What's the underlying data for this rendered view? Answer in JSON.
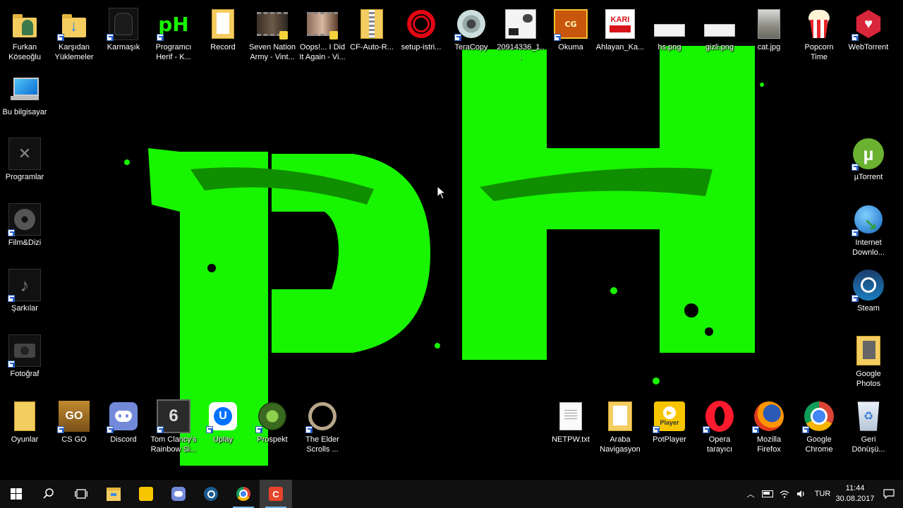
{
  "desktop": {
    "icons": {
      "furkan": "Furkan\nKöseoğlu",
      "downloads": "Karşıdan\nYüklemeler",
      "karmasik": "Karmaşık",
      "programci": "Programcı\nHerif - K...",
      "record": "Record",
      "seven_nation": "Seven Nation\nArmy - Vint...",
      "oops": "Oops!... I Did\nIt Again - Vi...",
      "cf_auto": "CF-Auto-R...",
      "setup_istri": "setup-istri...",
      "teracopy": "TeraCopy",
      "file_2091": "20914336_1...",
      "okuma": "Okuma",
      "ahlayan": "Ahlayan_Ka...",
      "hs_png": "hs.png",
      "gizli_png": "gizli.png",
      "cat_jpg": "cat.jpg",
      "popcorn": "Popcorn\nTime",
      "webtorrent": "WebTorrent",
      "bu_bilgisayar": "Bu bilgisayar",
      "programlar": "Programlar",
      "film_dizi": "Film&Dizi",
      "sarkilar": "Şarkılar",
      "fotograf": "Fotoğraf",
      "utorrent": "µTorrent",
      "idm": "Internet\nDownlo...",
      "steam": "Steam",
      "google_photos": "Google\nPhotos",
      "oyunlar": "Oyunlar",
      "csgo": "CS GO",
      "discord": "Discord",
      "rainbow": "Tom Clancy's\nRainbow Si...",
      "uplay": "Uplay",
      "prospekt": "Prospekt",
      "elder_scrolls": "The Elder\nScrolls ...",
      "netpw": "NETPW.txt",
      "araba": "Araba\nNavigasyon",
      "potplayer": "PotPlayer",
      "opera": "Opera\ntarayıcı",
      "firefox": "Mozilla\nFirefox",
      "chrome": "Google\nChrome",
      "recycle": "Geri\nDönüşü..."
    },
    "icon_badges": {
      "programci_logo": "pH",
      "csgo_logo": "GO",
      "potplayer_logo": "Player",
      "karga_logo": "KARI",
      "wallpaper_text": "pH"
    },
    "accent_green": "#18f500"
  },
  "taskbar": {
    "language": "TUR",
    "time": "11:44",
    "date": "30.08.2017",
    "pinned": [
      "windows-start",
      "search",
      "task-view",
      "file-explorer",
      "potplayer",
      "discord",
      "steam",
      "chrome",
      "camtasia"
    ]
  }
}
